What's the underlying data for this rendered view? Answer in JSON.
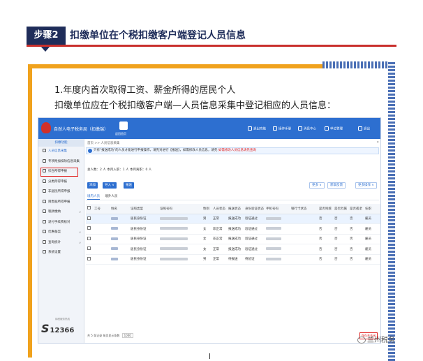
{
  "step": {
    "tag": "步骤2",
    "title": "扣缴单位在个税扣缴客户端登记人员信息"
  },
  "intro": {
    "line1": "1.年度内首次取得工资、薪金所得的居民个人",
    "line2": "扣缴单位应在个税扣缴客户端—人员信息采集中登记相应的人员信息："
  },
  "app": {
    "title": "自然人电子税务局（扣缴端）",
    "home_label": "返回首页",
    "top_menu": [
      "退出功能",
      "操作手册",
      "消息中心",
      "单位管理",
      "退出"
    ],
    "sidebar_header": "扣缴功能",
    "sidebar_items": [
      {
        "label": "人员信息采集",
        "icon": "person-icon"
      },
      {
        "label": "专项附加扣除信息采集",
        "icon": "id-card-icon"
      },
      {
        "label": "综合所得申报",
        "icon": "gear-icon"
      },
      {
        "label": "分类所得申报",
        "icon": "clock-icon"
      },
      {
        "label": "非居民所得申报",
        "icon": "person-icon"
      },
      {
        "label": "限售股所得申报",
        "icon": "bar-chart-icon"
      },
      {
        "label": "税款缴纳",
        "icon": "wallet-icon"
      },
      {
        "label": "退付手续费核对",
        "icon": "document-icon"
      },
      {
        "label": "优惠备案",
        "icon": "folder-icon"
      },
      {
        "label": "查询统计",
        "icon": "chart-icon"
      },
      {
        "label": "系统设置",
        "icon": "gear-icon"
      }
    ],
    "logo_text": "12366",
    "logo_sub": "纳税服务热线",
    "breadcrumb": "首页 >> 人员信息采集",
    "notice": "只有\"报送成功\"的人员才能进行申报操作，请先对进行【报送】，如需修改人员信息，请先",
    "notice_warn": "如需修改人员信息请先查询",
    "stats": "总人数：2 人   本月入职：1 人   本月离职：0 人",
    "buttons": {
      "add": "添加",
      "import": "导入",
      "report": "报送",
      "more": "更多",
      "fetch": "获取反馈",
      "more_ops": "更多操作"
    },
    "tabs": [
      "境内人员",
      "境外人员"
    ],
    "columns": [
      "",
      "工号",
      "姓名",
      "证照类型",
      "证照号码",
      "性别",
      "人员状态",
      "报送状态",
      "身份验证状态",
      "手机号码",
      "银行卡状态",
      "是否残疾",
      "是否烈属",
      "是否孤老",
      "任职"
    ],
    "rows": [
      {
        "id_type": "居民身份证",
        "gender": "男",
        "status": "正常",
        "report": "报送成功",
        "verify": "验证通过",
        "d1": "否",
        "d2": "否",
        "d3": "否",
        "job": "雇员"
      },
      {
        "id_type": "居民身份证",
        "gender": "女",
        "status": "非正常",
        "report": "报送成功",
        "verify": "验证通过",
        "d1": "否",
        "d2": "否",
        "d3": "否",
        "job": "雇员"
      },
      {
        "id_type": "居民身份证",
        "gender": "女",
        "status": "非正常",
        "report": "报送成功",
        "verify": "验证通过",
        "d1": "否",
        "d2": "否",
        "d3": "否",
        "job": "雇员"
      },
      {
        "id_type": "居民身份证",
        "gender": "女",
        "status": "正常",
        "report": "报送成功",
        "verify": "验证通过",
        "d1": "否",
        "d2": "否",
        "d3": "否",
        "job": "雇员"
      },
      {
        "id_type": "居民身份证",
        "gender": "男",
        "status": "正常",
        "report": "待报送",
        "verify": "待验证",
        "d1": "否",
        "d2": "否",
        "d3": "否",
        "job": "雇员"
      }
    ],
    "footer": "共 5 条记录   每页显示条数",
    "page_size": "1000",
    "save_label": "保存并关闭"
  },
  "watermark": "兰州税务",
  "colors": {
    "brand_blue": "#2d6fd0",
    "title_navy": "#1f2d5a",
    "accent_red": "#c9302c",
    "frame_orange": "#f0a21d"
  }
}
